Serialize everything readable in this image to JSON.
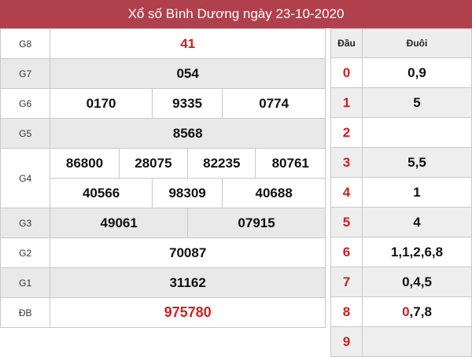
{
  "header": {
    "title": "Xổ số Bình Dương ngày 23-10-2020"
  },
  "results": {
    "g8_label": "G8",
    "g8": "41",
    "g7_label": "G7",
    "g7": "054",
    "g6_label": "G6",
    "g6": [
      "0170",
      "9335",
      "0774"
    ],
    "g5_label": "G5",
    "g5": "8568",
    "g4_label": "G4",
    "g4": [
      "86800",
      "28075",
      "82235",
      "80761",
      "40566",
      "98309",
      "40688"
    ],
    "g3_label": "G3",
    "g3": [
      "49061",
      "07915"
    ],
    "g2_label": "G2",
    "g2": "70087",
    "g1_label": "G1",
    "g1": "31162",
    "db_label": "ĐB",
    "db": "975780"
  },
  "loto": {
    "col_dau": "Đầu",
    "col_duoi": "Đuôi",
    "rows": [
      {
        "dau": "0",
        "duoi": "0,9"
      },
      {
        "dau": "1",
        "duoi": "5"
      },
      {
        "dau": "2",
        "duoi": ""
      },
      {
        "dau": "3",
        "duoi": "5,5"
      },
      {
        "dau": "4",
        "duoi": "1"
      },
      {
        "dau": "5",
        "duoi": "4"
      },
      {
        "dau": "6",
        "duoi": "1,1,2,6,8"
      },
      {
        "dau": "7",
        "duoi": "0,4,5"
      },
      {
        "dau": "8",
        "duoi_red": "0",
        "duoi_rest": ",7,8"
      },
      {
        "dau": "9",
        "duoi": ""
      }
    ]
  }
}
